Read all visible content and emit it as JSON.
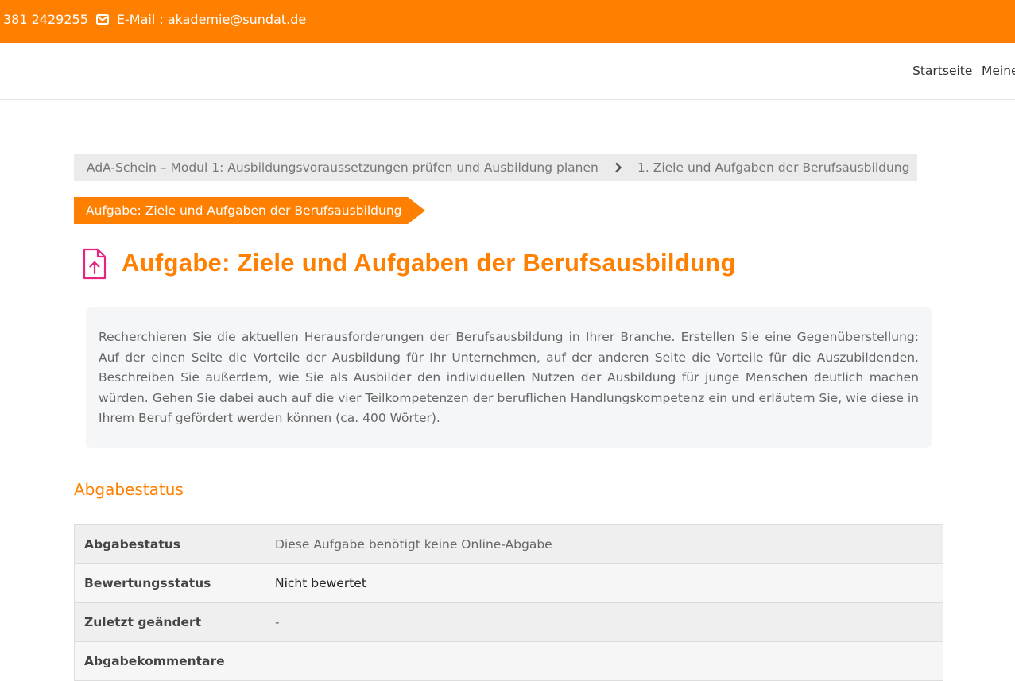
{
  "topbar": {
    "phone": "381 2429255",
    "email_label": "E-Mail : akademie@sundat.de",
    "color": "#ff7f00"
  },
  "nav": {
    "items": [
      "Startseite",
      "Meine"
    ]
  },
  "breadcrumb": {
    "items": [
      "AdA-Schein – Modul 1: Ausbildungsvoraussetzungen prüfen und Ausbildung planen",
      "1. Ziele und Aufgaben der Berufsausbildung"
    ]
  },
  "tag_label": "Aufgabe: Ziele und Aufgaben der Berufsausbildung",
  "page_title": "Aufgabe: Ziele und Aufgaben der Berufsausbildung",
  "icons": {
    "title_icon": "file-upload-icon",
    "mail_icon": "envelope-icon",
    "separator_icon": "chevron-right-icon"
  },
  "intro_text": "Recherchieren Sie die aktuellen Herausforderungen der Berufsausbildung in Ihrer Branche. Erstellen Sie eine Gegenüberstellung: Auf der einen Seite die Vorteile der Ausbildung für Ihr Unternehmen, auf der anderen Seite die Vorteile für die Auszubildenden. Beschreiben Sie außerdem, wie Sie als Ausbilder den individuellen Nutzen der Ausbildung für junge Menschen deutlich machen würden. Gehen Sie dabei auch auf die vier Teilkompetenzen der beruflichen Handlungskompetenz ein und erläutern Sie, wie diese in Ihrem Beruf gefördert werden können (ca. 400 Wörter).",
  "submission": {
    "heading": "Abgabestatus",
    "rows": [
      {
        "label": "Abgabestatus",
        "value": "Diese Aufgabe benötigt keine Online-Abgabe"
      },
      {
        "label": "Bewertungsstatus",
        "value": "Nicht bewertet"
      },
      {
        "label": "Zuletzt geändert",
        "value": "-"
      },
      {
        "label": "Abgabekommentare",
        "value": ""
      }
    ]
  },
  "colors": {
    "accent": "#ff7f00",
    "icon_pink": "#e8237f"
  }
}
